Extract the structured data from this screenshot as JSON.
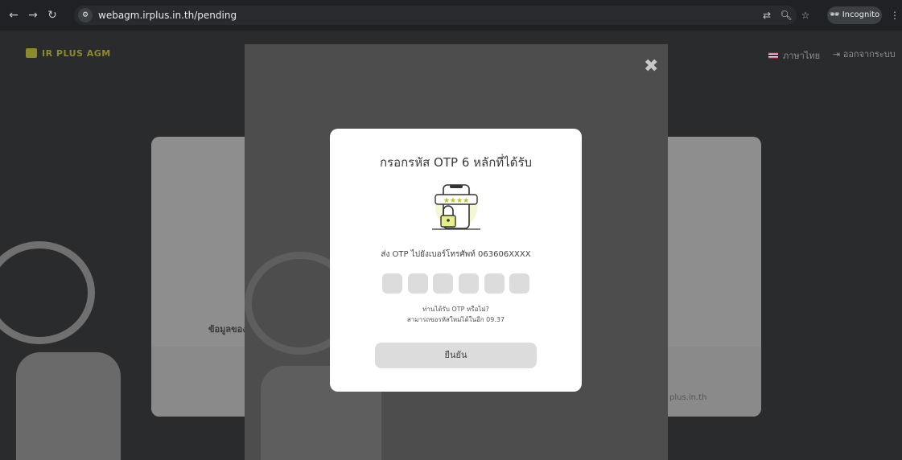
{
  "browser": {
    "back_glyph": "←",
    "forward_glyph": "→",
    "reload_glyph": "↻",
    "url": "webagm.irplus.in.th/pending",
    "incognito_label": "Incognito"
  },
  "header": {
    "brand": "IR PLUS AGM",
    "language": "ภาษาไทย",
    "logout": "ออกจากระบบ"
  },
  "background": {
    "card_label": "ข้อมูลของ",
    "card_footer_text": "plus.in.th"
  },
  "dialog": {
    "title": "กรอกรหัส OTP 6 หลักที่ได้รับ",
    "sent_to": "ส่ง OTP ไปยังเบอร์โทรศัพท์ 063606XXXX",
    "otp_boxes": [
      "",
      "",
      "",
      "",
      "",
      ""
    ],
    "not_received": "ท่านได้รับ OTP หรือไม่?",
    "resend": "สามารถขอรหัสใหม่ได้ในอีก 09.37",
    "confirm_label": "ยืนยัน",
    "close_glyph": "✖",
    "illustration_icon": "phone-lock-icon",
    "stars": "★★★★"
  },
  "colors": {
    "brand": "#8c8a2b",
    "dialog_bg": "#ffffff",
    "otp_box": "#dcdcdc",
    "overlay": "#4d4d4d"
  }
}
